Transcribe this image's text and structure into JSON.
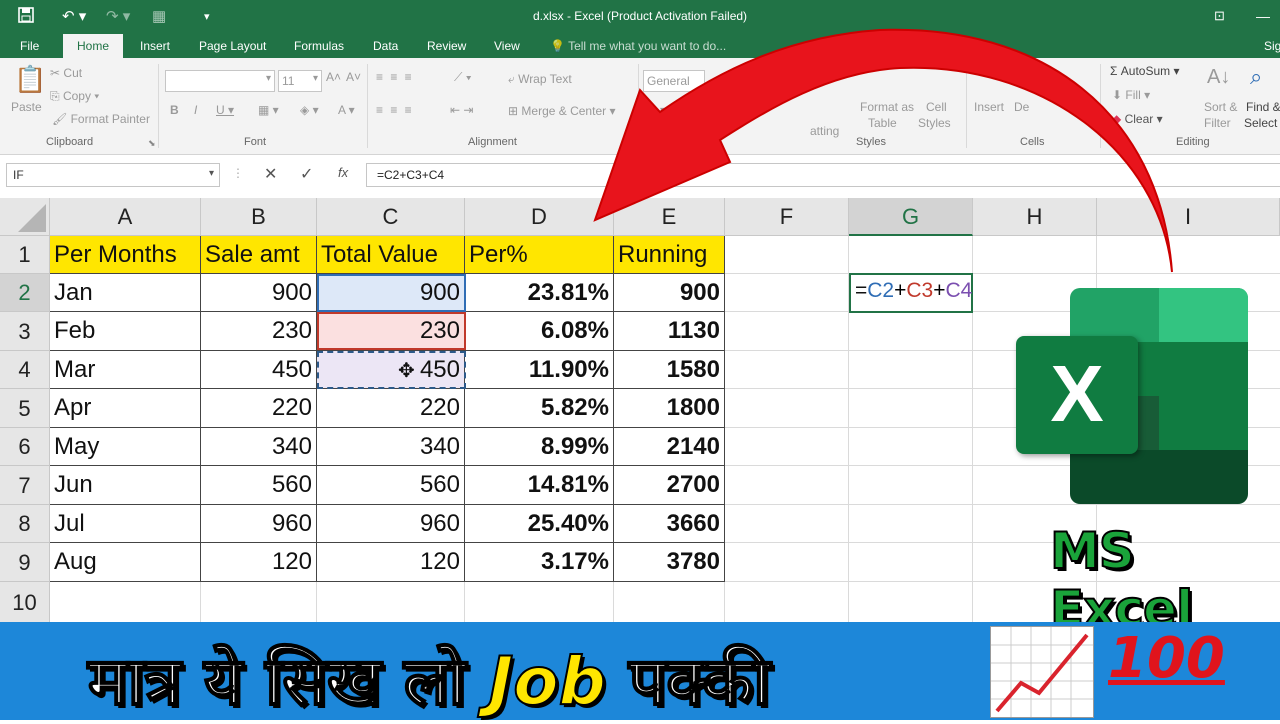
{
  "window": {
    "title": "d.xlsx - Excel (Product Activation Failed)",
    "user_partial": "Sig"
  },
  "tabs": [
    "File",
    "Home",
    "Insert",
    "Page Layout",
    "Formulas",
    "Data",
    "Review",
    "View"
  ],
  "active_tab": "Home",
  "tell_me": "Tell me what you want to do...",
  "ribbon": {
    "clipboard": {
      "paste": "Paste",
      "cut": "Cut",
      "copy": "Copy",
      "format_painter": "Format Painter",
      "group": "Clipboard"
    },
    "font": {
      "size": "11",
      "group": "Font"
    },
    "alignment": {
      "wrap_text": "Wrap Text",
      "merge_center": "Merge & Center",
      "group": "Alignment"
    },
    "number": {
      "format": "General"
    },
    "styles": {
      "conditional_partial": "atting",
      "format_as_table": "Format as",
      "table": "Table",
      "cell": "Cell",
      "cell_styles": "Styles",
      "group": "Styles"
    },
    "cells": {
      "insert": "Insert",
      "delete_partial": "De",
      "group": "Cells"
    },
    "editing": {
      "autosum": "AutoSum",
      "fill": "Fill",
      "clear": "Clear",
      "sort_filter": "Sort &",
      "filter": "Filter",
      "find": "Find &",
      "select": "Select",
      "group": "Editing"
    }
  },
  "formula_bar": {
    "name_box": "IF",
    "formula": "=C2+C3+C4",
    "fx": "fx"
  },
  "columns": [
    "A",
    "B",
    "C",
    "D",
    "E",
    "F",
    "G",
    "H",
    "I"
  ],
  "table": {
    "headers": [
      "Per Months",
      "Sale amt",
      "Total Value",
      "Per%",
      "Running"
    ],
    "rows": [
      [
        "Jan",
        "900",
        "900",
        "23.81%",
        "900"
      ],
      [
        "Feb",
        "230",
        "230",
        "6.08%",
        "1130"
      ],
      [
        "Mar",
        "450",
        "450",
        "11.90%",
        "1580"
      ],
      [
        "Apr",
        "220",
        "220",
        "5.82%",
        "1800"
      ],
      [
        "May",
        "340",
        "340",
        "8.99%",
        "2140"
      ],
      [
        "Jun",
        "560",
        "560",
        "14.81%",
        "2700"
      ],
      [
        "Jul",
        "960",
        "960",
        "25.40%",
        "3660"
      ],
      [
        "Aug",
        "120",
        "120",
        "3.17%",
        "3780"
      ]
    ]
  },
  "row_numbers": [
    "1",
    "2",
    "3",
    "4",
    "5",
    "6",
    "7",
    "8",
    "9",
    "10"
  ],
  "edit_cell": {
    "eq": "=",
    "c2": "C2",
    "plus1": "+",
    "c3": "C3",
    "plus2": "+",
    "c4": "C4"
  },
  "logo": {
    "letter": "X",
    "caption": "MS Excel"
  },
  "banner": {
    "hindi_1": "मात्र ये सिख लो",
    "job": "Job",
    "hindi_2": "पक्की"
  },
  "colors": {
    "excel_green": "#217346",
    "header_yellow": "#ffe600",
    "banner_blue": "#1d87d9",
    "arrow_red": "#e8141c",
    "ref_blue": "#2f6db5",
    "ref_red": "#c0392b",
    "ref_purple": "#7b4fb0"
  }
}
